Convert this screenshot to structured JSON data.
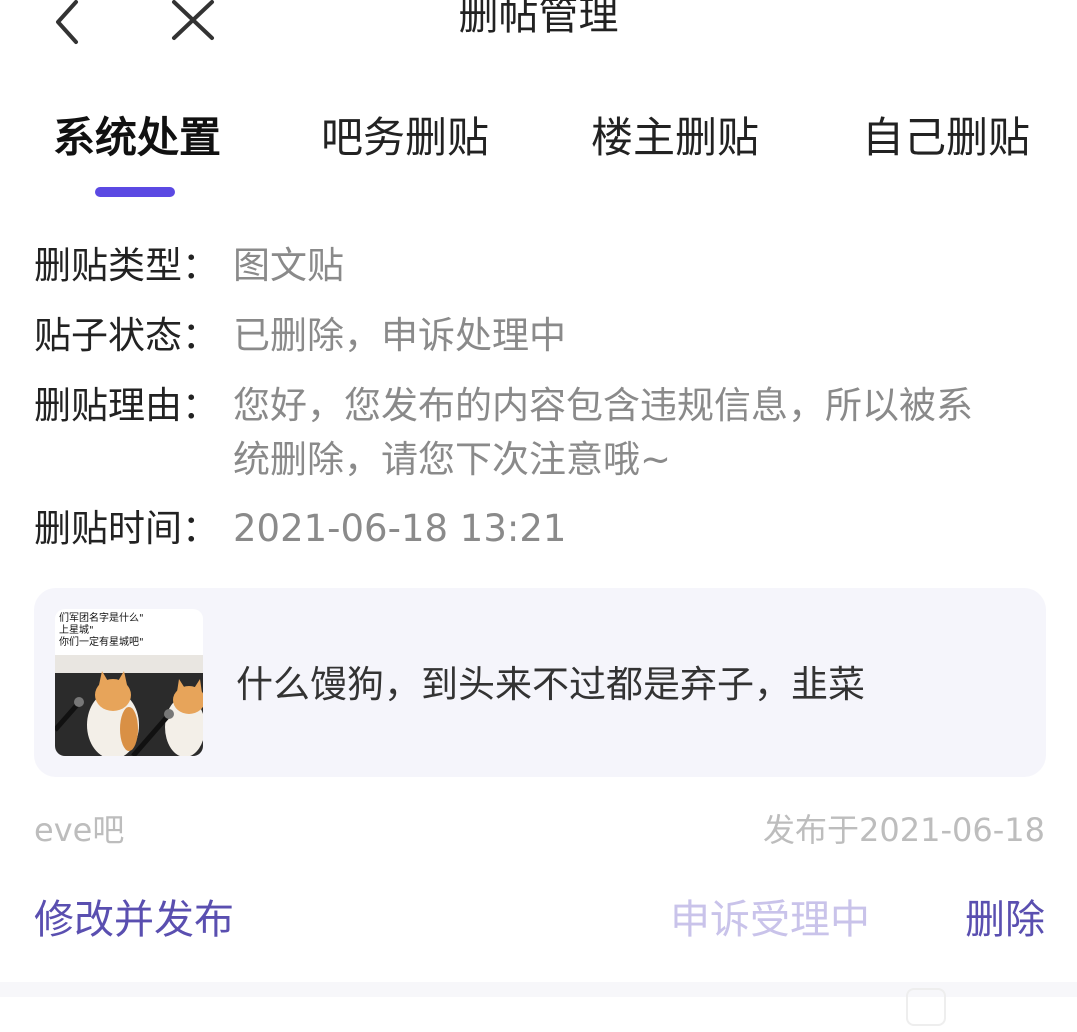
{
  "header": {
    "title": "删帖管理"
  },
  "tabs": [
    {
      "label": "系统处置",
      "active": true
    },
    {
      "label": "吧务删贴",
      "active": false
    },
    {
      "label": "楼主删贴",
      "active": false
    },
    {
      "label": "自己删贴",
      "active": false
    }
  ],
  "details": {
    "type_label": "删贴类型：",
    "type_value": "图文贴",
    "status_label": "贴子状态：",
    "status_value": "已删除，申诉处理中",
    "reason_label": "删贴理由：",
    "reason_value_line1": "您好，您发布的内容包含违规信息，所以被系",
    "reason_value_line2": "统删除，请您下次注意哦~",
    "time_label": "删贴时间：",
    "time_value": "2021-06-18 13:21"
  },
  "post": {
    "thumbnail_caption": "们军团名字是什么\"\n上星城\"\n你们一定有星城吧\"",
    "text": "什么馒狗，到头来不过都是弃子，韭菜",
    "forum": "eve吧",
    "published": "发布于2021-06-18"
  },
  "actions": {
    "edit_publish": "修改并发布",
    "appeal_status": "申诉受理中",
    "delete": "删除"
  },
  "colors": {
    "accent": "#5b49e3",
    "action_text": "#5a4fb0",
    "muted_text": "#8a8a8a",
    "card_bg": "#f5f5fb"
  }
}
